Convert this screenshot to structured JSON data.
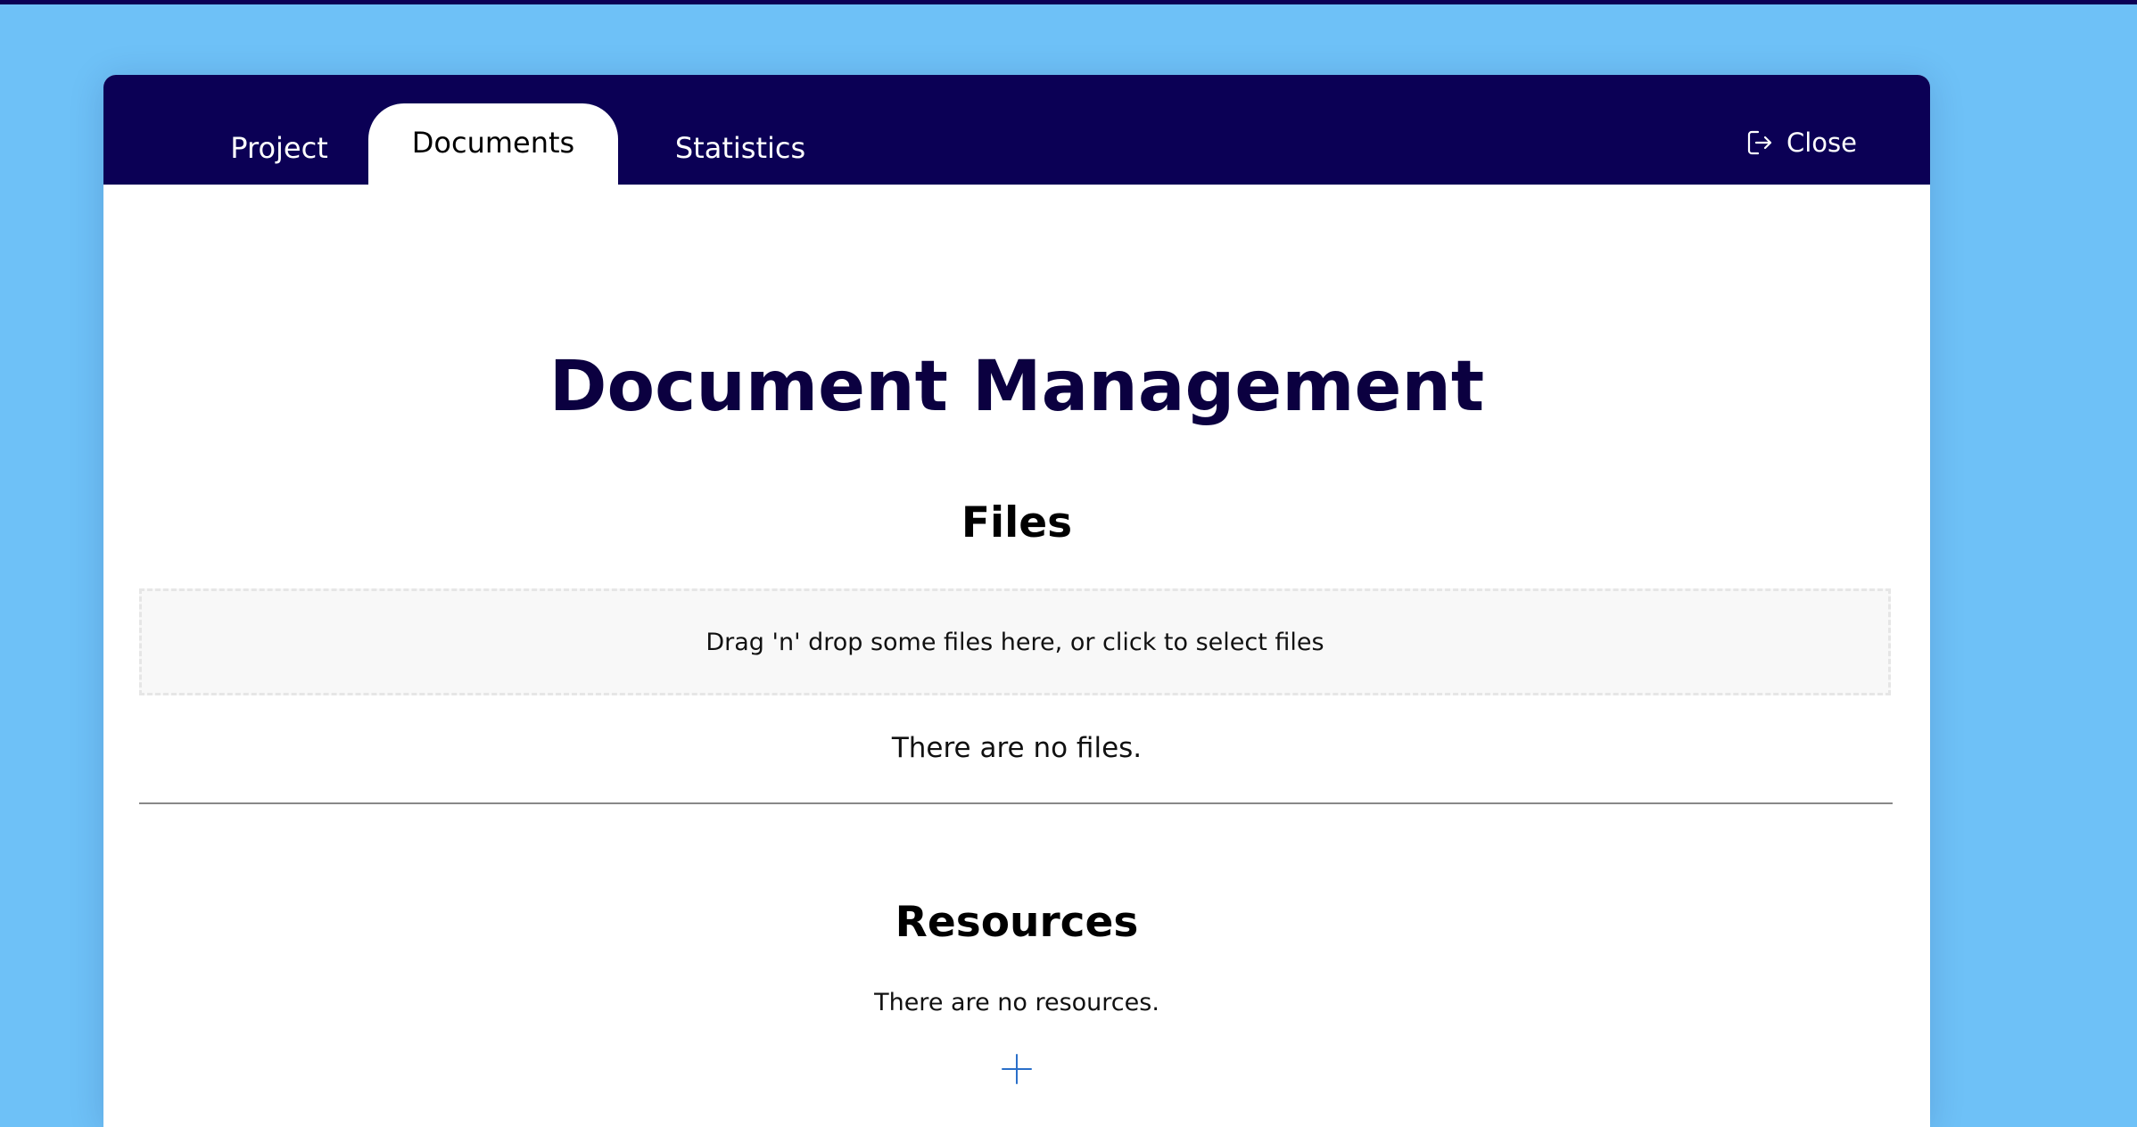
{
  "tabs": [
    {
      "label": "Project"
    },
    {
      "label": "Documents",
      "active": true
    },
    {
      "label": "Statistics"
    }
  ],
  "header": {
    "close_label": "Close",
    "close_icon": "exit-icon"
  },
  "main": {
    "title": "Document Management",
    "files": {
      "title": "Files",
      "dropzone_text": "Drag 'n' drop some files here, or click to select files",
      "empty_text": "There are no files."
    },
    "resources": {
      "title": "Resources",
      "empty_text": "There are no resources.",
      "add_icon": "plus-icon"
    }
  },
  "colors": {
    "background": "#6ec1f7",
    "header": "#0b0055",
    "title": "#0b0040",
    "accent": "#2a6fc9"
  }
}
